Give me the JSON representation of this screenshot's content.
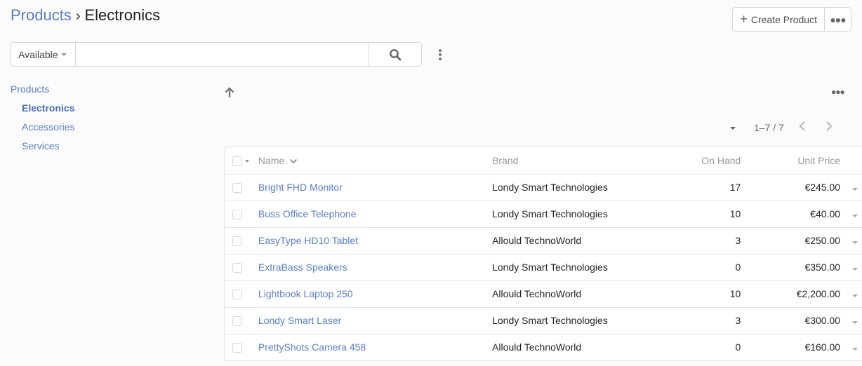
{
  "breadcrumb": {
    "parent": "Products",
    "separator": "›",
    "current": "Electronics"
  },
  "actions": {
    "create_label": "Create Product",
    "create_icon": "plus-icon",
    "more_icon": "ellipsis-icon"
  },
  "search": {
    "filter_value": "Available",
    "placeholder": "",
    "value": "",
    "search_icon": "search-icon",
    "options_icon": "kebab-icon"
  },
  "sidebar": {
    "items": [
      {
        "label": "Products",
        "level": 0,
        "active": false
      },
      {
        "label": "Electronics",
        "level": 1,
        "active": true
      },
      {
        "label": "Accessories",
        "level": 1,
        "active": false
      },
      {
        "label": "Services",
        "level": 1,
        "active": false
      }
    ]
  },
  "list": {
    "up_icon": "arrow-up-icon",
    "more_icon": "ellipsis-icon",
    "pager": {
      "range": "1–7 / 7",
      "prev_icon": "chevron-left-icon",
      "next_icon": "chevron-right-icon"
    },
    "columns": {
      "name": "Name",
      "brand": "Brand",
      "on_hand": "On Hand",
      "unit_price": "Unit Price"
    },
    "sort": {
      "column": "name",
      "direction": "descending-indicator"
    },
    "rows": [
      {
        "name": "Bright FHD Monitor",
        "brand": "Londy Smart Technologies",
        "on_hand": "17",
        "unit_price": "€245.00"
      },
      {
        "name": "Buss Office Telephone",
        "brand": "Londy Smart Technologies",
        "on_hand": "10",
        "unit_price": "€40.00"
      },
      {
        "name": "EasyType HD10 Tablet",
        "brand": "Allould TechnoWorld",
        "on_hand": "3",
        "unit_price": "€250.00"
      },
      {
        "name": "ExtraBass Speakers",
        "brand": "Londy Smart Technologies",
        "on_hand": "0",
        "unit_price": "€350.00"
      },
      {
        "name": "Lightbook Laptop 250",
        "brand": "Allould TechnoWorld",
        "on_hand": "10",
        "unit_price": "€2,200.00"
      },
      {
        "name": "Londy Smart Laser",
        "brand": "Londy Smart Technologies",
        "on_hand": "3",
        "unit_price": "€300.00"
      },
      {
        "name": "PrettyShots Camera 458",
        "brand": "Allould TechnoWorld",
        "on_hand": "0",
        "unit_price": "€160.00"
      }
    ]
  },
  "colors": {
    "link": "#5b7ec9",
    "border": "#e3e4ea",
    "background": "#fbfbfc"
  }
}
